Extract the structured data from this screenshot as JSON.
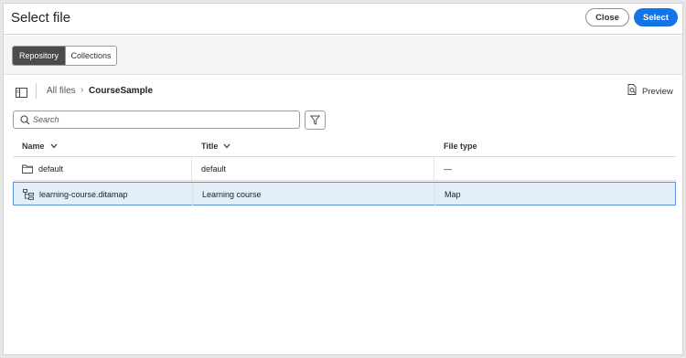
{
  "dialog": {
    "title": "Select file",
    "close_label": "Close",
    "select_label": "Select",
    "accent_color": "#1473e6"
  },
  "tabs": [
    {
      "label": "Repository",
      "active": true
    },
    {
      "label": "Collections",
      "active": false
    }
  ],
  "breadcrumb": {
    "root": "All files",
    "separator": "›",
    "current": "CourseSample"
  },
  "preview_label": "Preview",
  "search": {
    "placeholder": "Search",
    "value": ""
  },
  "table": {
    "columns": [
      "Name",
      "Title",
      "File type"
    ],
    "rows": [
      {
        "name": "default",
        "title": "default",
        "file_type": "—",
        "icon": "folder-icon",
        "selected": false
      },
      {
        "name": "learning-course.ditamap",
        "title": "Learning course",
        "file_type": "Map",
        "icon": "ditamap-icon",
        "selected": true
      }
    ]
  }
}
